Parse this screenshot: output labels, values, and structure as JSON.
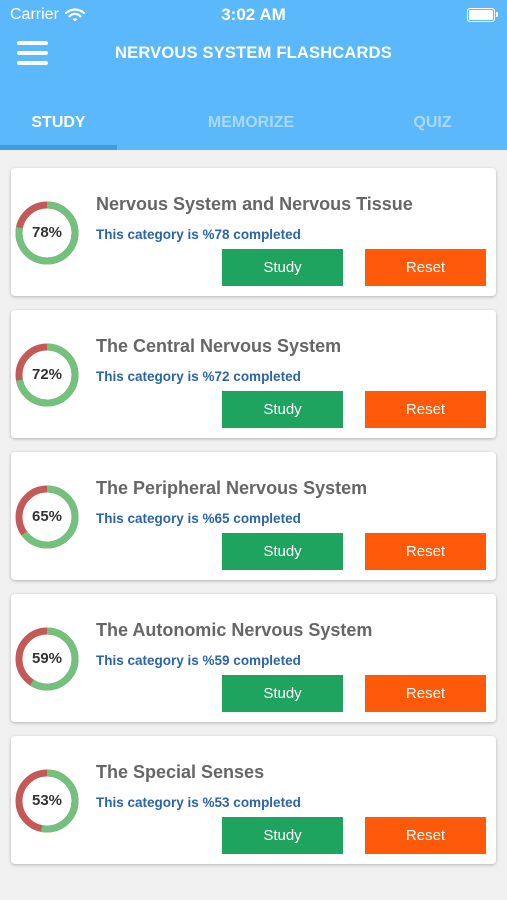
{
  "status_bar": {
    "carrier": "Carrier",
    "time": "3:02 AM"
  },
  "header": {
    "title": "NERVOUS SYSTEM FLASHCARDS",
    "tabs": [
      {
        "label": "STUDY",
        "active": true
      },
      {
        "label": "MEMORIZE",
        "active": false
      },
      {
        "label": "QUIZ",
        "active": false
      }
    ]
  },
  "colors": {
    "header_bg": "#5bb8fb",
    "ring_complete": "#72c17d",
    "ring_remaining": "#c45a57",
    "study_button": "#1fa45f",
    "reset_button": "#fe5a0a",
    "status_text": "#2a64ac"
  },
  "categories": [
    {
      "title": "Nervous System and Nervous Tissue",
      "percent_label": "78%",
      "percent": 78,
      "status": "This category is %78 completed",
      "study_label": "Study",
      "reset_label": "Reset"
    },
    {
      "title": "The Central Nervous System",
      "percent_label": "72%",
      "percent": 72,
      "status": "This category is %72 completed",
      "study_label": "Study",
      "reset_label": "Reset"
    },
    {
      "title": "The Peripheral Nervous System",
      "percent_label": "65%",
      "percent": 65,
      "status": "This category is %65 completed",
      "study_label": "Study",
      "reset_label": "Reset"
    },
    {
      "title": "The Autonomic Nervous System",
      "percent_label": "59%",
      "percent": 59,
      "status": "This category is %59 completed",
      "study_label": "Study",
      "reset_label": "Reset"
    },
    {
      "title": "The Special Senses",
      "percent_label": "53%",
      "percent": 53,
      "status": "This category is %53 completed",
      "study_label": "Study",
      "reset_label": "Reset"
    }
  ]
}
